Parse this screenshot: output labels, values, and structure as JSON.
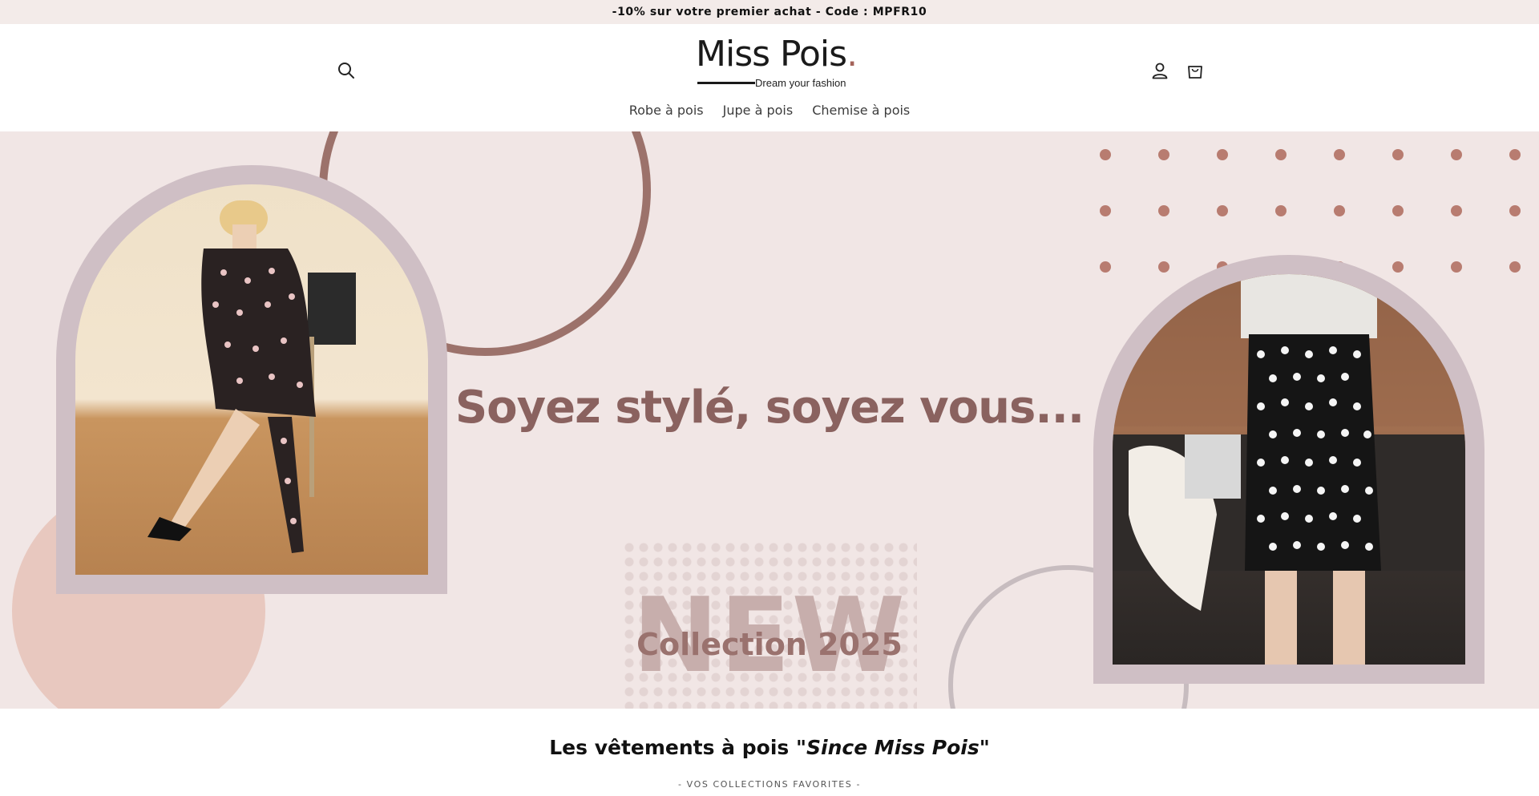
{
  "announcement": {
    "text": "-10% sur votre premier achat - Code : MPFR10"
  },
  "header": {
    "search_icon": "search-icon",
    "account_icon": "user-icon",
    "cart_icon": "cart-icon",
    "logo": {
      "name": "Miss Pois",
      "dot": ".",
      "tagline": "Dream your fashion"
    },
    "nav": [
      {
        "label": "Robe à pois"
      },
      {
        "label": "Jupe à pois"
      },
      {
        "label": "Chemise à pois"
      }
    ]
  },
  "hero": {
    "slogan": "Soyez stylé, soyez vous...",
    "new_label": "NEW",
    "collection_label": "Collection 2025",
    "colors": {
      "background": "#f1e6e5",
      "accent": "#9c726b",
      "dots": "#b87c70"
    }
  },
  "section": {
    "title_prefix": "Les vêtements à pois \"",
    "title_emphasis": "Since Miss Pois",
    "title_suffix": "\"",
    "subtitle": "- VOS COLLECTIONS FAVORITES -"
  }
}
